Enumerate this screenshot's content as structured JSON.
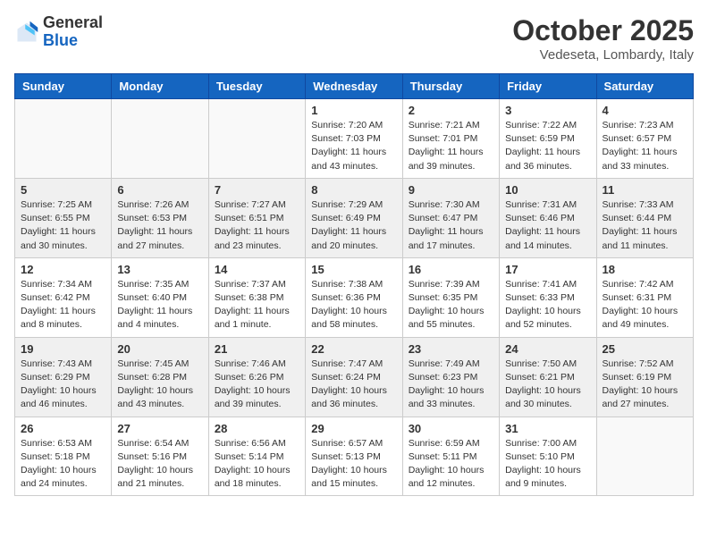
{
  "header": {
    "logo_general": "General",
    "logo_blue": "Blue",
    "month_title": "October 2025",
    "location": "Vedeseta, Lombardy, Italy"
  },
  "weekdays": [
    "Sunday",
    "Monday",
    "Tuesday",
    "Wednesday",
    "Thursday",
    "Friday",
    "Saturday"
  ],
  "weeks": [
    [
      {
        "day": "",
        "info": ""
      },
      {
        "day": "",
        "info": ""
      },
      {
        "day": "",
        "info": ""
      },
      {
        "day": "1",
        "info": "Sunrise: 7:20 AM\nSunset: 7:03 PM\nDaylight: 11 hours\nand 43 minutes."
      },
      {
        "day": "2",
        "info": "Sunrise: 7:21 AM\nSunset: 7:01 PM\nDaylight: 11 hours\nand 39 minutes."
      },
      {
        "day": "3",
        "info": "Sunrise: 7:22 AM\nSunset: 6:59 PM\nDaylight: 11 hours\nand 36 minutes."
      },
      {
        "day": "4",
        "info": "Sunrise: 7:23 AM\nSunset: 6:57 PM\nDaylight: 11 hours\nand 33 minutes."
      }
    ],
    [
      {
        "day": "5",
        "info": "Sunrise: 7:25 AM\nSunset: 6:55 PM\nDaylight: 11 hours\nand 30 minutes."
      },
      {
        "day": "6",
        "info": "Sunrise: 7:26 AM\nSunset: 6:53 PM\nDaylight: 11 hours\nand 27 minutes."
      },
      {
        "day": "7",
        "info": "Sunrise: 7:27 AM\nSunset: 6:51 PM\nDaylight: 11 hours\nand 23 minutes."
      },
      {
        "day": "8",
        "info": "Sunrise: 7:29 AM\nSunset: 6:49 PM\nDaylight: 11 hours\nand 20 minutes."
      },
      {
        "day": "9",
        "info": "Sunrise: 7:30 AM\nSunset: 6:47 PM\nDaylight: 11 hours\nand 17 minutes."
      },
      {
        "day": "10",
        "info": "Sunrise: 7:31 AM\nSunset: 6:46 PM\nDaylight: 11 hours\nand 14 minutes."
      },
      {
        "day": "11",
        "info": "Sunrise: 7:33 AM\nSunset: 6:44 PM\nDaylight: 11 hours\nand 11 minutes."
      }
    ],
    [
      {
        "day": "12",
        "info": "Sunrise: 7:34 AM\nSunset: 6:42 PM\nDaylight: 11 hours\nand 8 minutes."
      },
      {
        "day": "13",
        "info": "Sunrise: 7:35 AM\nSunset: 6:40 PM\nDaylight: 11 hours\nand 4 minutes."
      },
      {
        "day": "14",
        "info": "Sunrise: 7:37 AM\nSunset: 6:38 PM\nDaylight: 11 hours\nand 1 minute."
      },
      {
        "day": "15",
        "info": "Sunrise: 7:38 AM\nSunset: 6:36 PM\nDaylight: 10 hours\nand 58 minutes."
      },
      {
        "day": "16",
        "info": "Sunrise: 7:39 AM\nSunset: 6:35 PM\nDaylight: 10 hours\nand 55 minutes."
      },
      {
        "day": "17",
        "info": "Sunrise: 7:41 AM\nSunset: 6:33 PM\nDaylight: 10 hours\nand 52 minutes."
      },
      {
        "day": "18",
        "info": "Sunrise: 7:42 AM\nSunset: 6:31 PM\nDaylight: 10 hours\nand 49 minutes."
      }
    ],
    [
      {
        "day": "19",
        "info": "Sunrise: 7:43 AM\nSunset: 6:29 PM\nDaylight: 10 hours\nand 46 minutes."
      },
      {
        "day": "20",
        "info": "Sunrise: 7:45 AM\nSunset: 6:28 PM\nDaylight: 10 hours\nand 43 minutes."
      },
      {
        "day": "21",
        "info": "Sunrise: 7:46 AM\nSunset: 6:26 PM\nDaylight: 10 hours\nand 39 minutes."
      },
      {
        "day": "22",
        "info": "Sunrise: 7:47 AM\nSunset: 6:24 PM\nDaylight: 10 hours\nand 36 minutes."
      },
      {
        "day": "23",
        "info": "Sunrise: 7:49 AM\nSunset: 6:23 PM\nDaylight: 10 hours\nand 33 minutes."
      },
      {
        "day": "24",
        "info": "Sunrise: 7:50 AM\nSunset: 6:21 PM\nDaylight: 10 hours\nand 30 minutes."
      },
      {
        "day": "25",
        "info": "Sunrise: 7:52 AM\nSunset: 6:19 PM\nDaylight: 10 hours\nand 27 minutes."
      }
    ],
    [
      {
        "day": "26",
        "info": "Sunrise: 6:53 AM\nSunset: 5:18 PM\nDaylight: 10 hours\nand 24 minutes."
      },
      {
        "day": "27",
        "info": "Sunrise: 6:54 AM\nSunset: 5:16 PM\nDaylight: 10 hours\nand 21 minutes."
      },
      {
        "day": "28",
        "info": "Sunrise: 6:56 AM\nSunset: 5:14 PM\nDaylight: 10 hours\nand 18 minutes."
      },
      {
        "day": "29",
        "info": "Sunrise: 6:57 AM\nSunset: 5:13 PM\nDaylight: 10 hours\nand 15 minutes."
      },
      {
        "day": "30",
        "info": "Sunrise: 6:59 AM\nSunset: 5:11 PM\nDaylight: 10 hours\nand 12 minutes."
      },
      {
        "day": "31",
        "info": "Sunrise: 7:00 AM\nSunset: 5:10 PM\nDaylight: 10 hours\nand 9 minutes."
      },
      {
        "day": "",
        "info": ""
      }
    ]
  ]
}
